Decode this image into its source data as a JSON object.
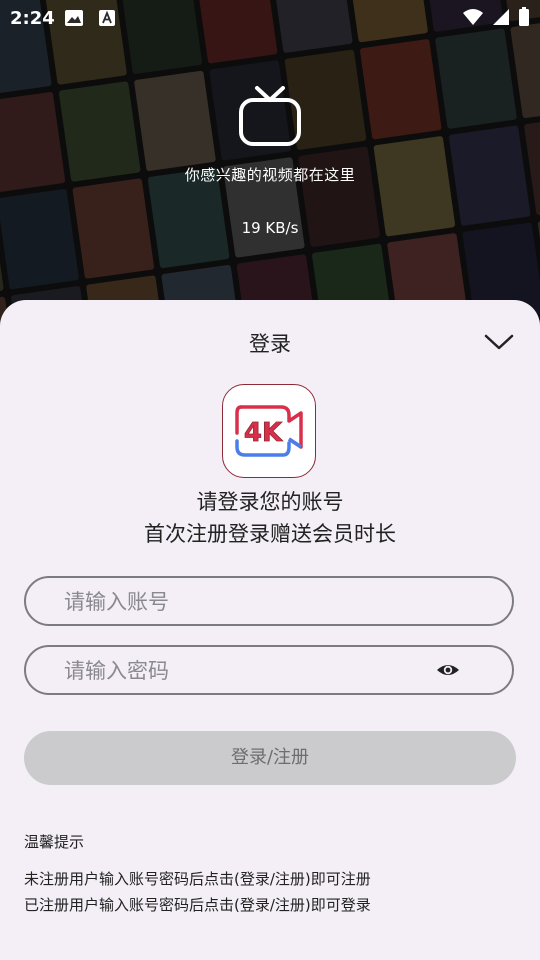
{
  "status_bar": {
    "time": "2:24",
    "icons": [
      "image-icon",
      "font-icon",
      "wifi-icon",
      "cellular-icon",
      "battery-icon"
    ]
  },
  "hero": {
    "icon": "tv-icon",
    "tagline": "你感兴趣的视频都在这里",
    "speed": "19 KB/s"
  },
  "sheet": {
    "title": "登录",
    "collapse_icon": "chevron-down-icon",
    "logo": {
      "text": "4K",
      "colors": {
        "red": "#d8304a",
        "blue": "#4a7ee8",
        "border": "#8d2a36"
      }
    },
    "prompt_line1": "请登录您的账号",
    "prompt_line2": "首次注册登录赠送会员时长",
    "account_field": {
      "value": "",
      "placeholder": "请输入账号"
    },
    "password_field": {
      "value": "",
      "placeholder": "请输入密码",
      "toggle_icon": "eye-icon"
    },
    "submit_label": "登录/注册",
    "tips": {
      "title": "温馨提示",
      "line1": "未注册用户输入账号密码后点击(登录/注册)即可注册",
      "line2": "已注册用户输入账号密码后点击(登录/注册)即可登录"
    }
  },
  "colors": {
    "sheet_bg": "#f4eff6",
    "field_border": "#7b7b80",
    "button_bg": "#cbcbcd",
    "button_text": "#6d6d70"
  }
}
